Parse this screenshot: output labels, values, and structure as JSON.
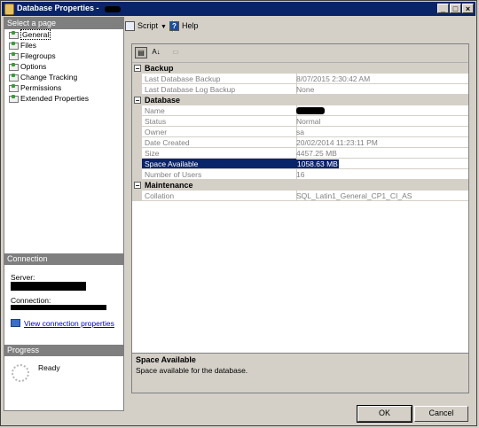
{
  "window": {
    "title": "Database Properties -"
  },
  "left": {
    "select_page_header": "Select a page",
    "pages": [
      {
        "label": "General",
        "selected": true
      },
      {
        "label": "Files"
      },
      {
        "label": "Filegroups"
      },
      {
        "label": "Options"
      },
      {
        "label": "Change Tracking"
      },
      {
        "label": "Permissions"
      },
      {
        "label": "Extended Properties"
      }
    ],
    "connection_header": "Connection",
    "server_label": "Server:",
    "connection_label": "Connection:",
    "view_connection_link": "View connection properties",
    "progress_header": "Progress",
    "progress_status": "Ready"
  },
  "toolbar": {
    "script_label": "Script",
    "help_label": "Help"
  },
  "grid": {
    "categories": [
      {
        "name": "Backup",
        "rows": [
          {
            "name": "Last Database Backup",
            "value": "8/07/2015 2:30:42 AM"
          },
          {
            "name": "Last Database Log Backup",
            "value": "None"
          }
        ]
      },
      {
        "name": "Database",
        "rows": [
          {
            "name": "Name",
            "value": ""
          },
          {
            "name": "Status",
            "value": "Normal"
          },
          {
            "name": "Owner",
            "value": "sa"
          },
          {
            "name": "Date Created",
            "value": "20/02/2014 11:23:11 PM"
          },
          {
            "name": "Size",
            "value": "4457.25 MB"
          },
          {
            "name": "Space Available",
            "value": "1058.63 MB",
            "selected": true
          },
          {
            "name": "Number of Users",
            "value": "16"
          }
        ]
      },
      {
        "name": "Maintenance",
        "rows": [
          {
            "name": "Collation",
            "value": "SQL_Latin1_General_CP1_CI_AS"
          }
        ]
      }
    ]
  },
  "description": {
    "title": "Space Available",
    "text": "Space available for the database."
  },
  "buttons": {
    "ok": "OK",
    "cancel": "Cancel"
  },
  "colors": {
    "titlebar": "#0a246a",
    "selection": "#0a246a",
    "face": "#d4d0c8",
    "link": "#0000cc"
  }
}
